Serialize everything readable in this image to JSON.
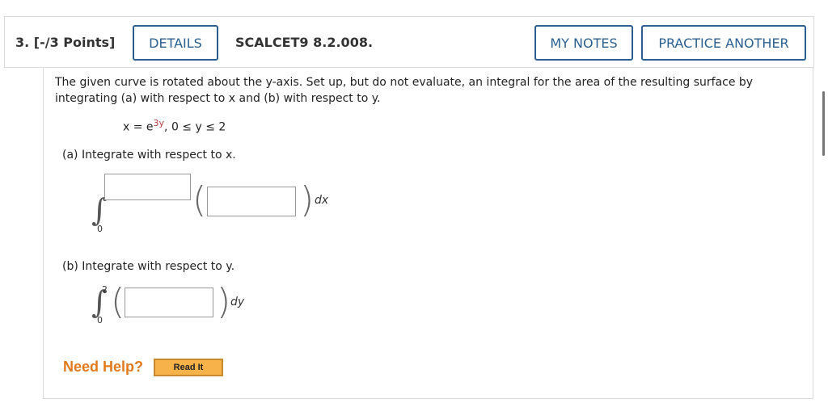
{
  "header": {
    "question_number": "3.  [-/3 Points]",
    "details_label": "DETAILS",
    "question_code": "SCALCET9 8.2.008.",
    "my_notes_label": "MY NOTES",
    "practice_label": "PRACTICE ANOTHER"
  },
  "problem": {
    "prompt": "The given curve is rotated about the y-axis. Set up, but do not evaluate, an integral for the area of the resulting surface by integrating (a) with respect to x and (b) with respect to y.",
    "equation_lhs": "x = e",
    "exponent": "3y",
    "range": ",    0 ≤ y ≤ 2"
  },
  "part_a": {
    "label": "(a)   Integrate with respect to x.",
    "integral_symbol": "∫",
    "lower_limit": "0",
    "upper_input_value": "",
    "body_input_value": "",
    "open_paren": "(",
    "close_paren": ")",
    "differential": "dx"
  },
  "part_b": {
    "label": "(b)   Integrate with respect to y.",
    "integral_symbol": "∫",
    "lower_limit": "0",
    "upper_limit": "2",
    "body_input_value": "",
    "open_paren": "(",
    "close_paren": ")",
    "differential": "dy"
  },
  "help": {
    "label": "Need Help?",
    "read_it_label": "Read It"
  },
  "colors": {
    "accent": "#2a5f8f",
    "help_orange": "#e07a1c",
    "read_it_bg": "#f7b24a"
  }
}
